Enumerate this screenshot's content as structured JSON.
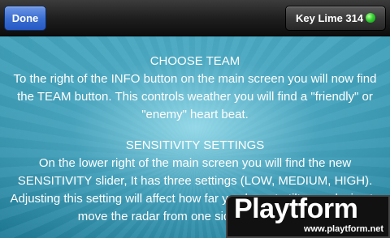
{
  "topbar": {
    "done_label": "Done",
    "device_name": "Key Lime 314",
    "status_color": "#33d033"
  },
  "sections": [
    {
      "title": "CHOOSE TEAM",
      "body": "To the right of the INFO button on the main screen you will now find the TEAM button.  This controls weather you will find a \"friendly\" or \"enemy\" heart beat."
    },
    {
      "title": "SENSITIVITY SETTINGS",
      "body": "On the lower right of the main screen you will find the new SENSITIVITY slider,  It has three settings (LOW, MEDIUM, HIGH).  Adjusting this setting will affect how far you have to tilt your device to move the radar from one side of the display"
    }
  ],
  "watermark": {
    "logo": "Playtform",
    "url": "www.playtform.net"
  }
}
